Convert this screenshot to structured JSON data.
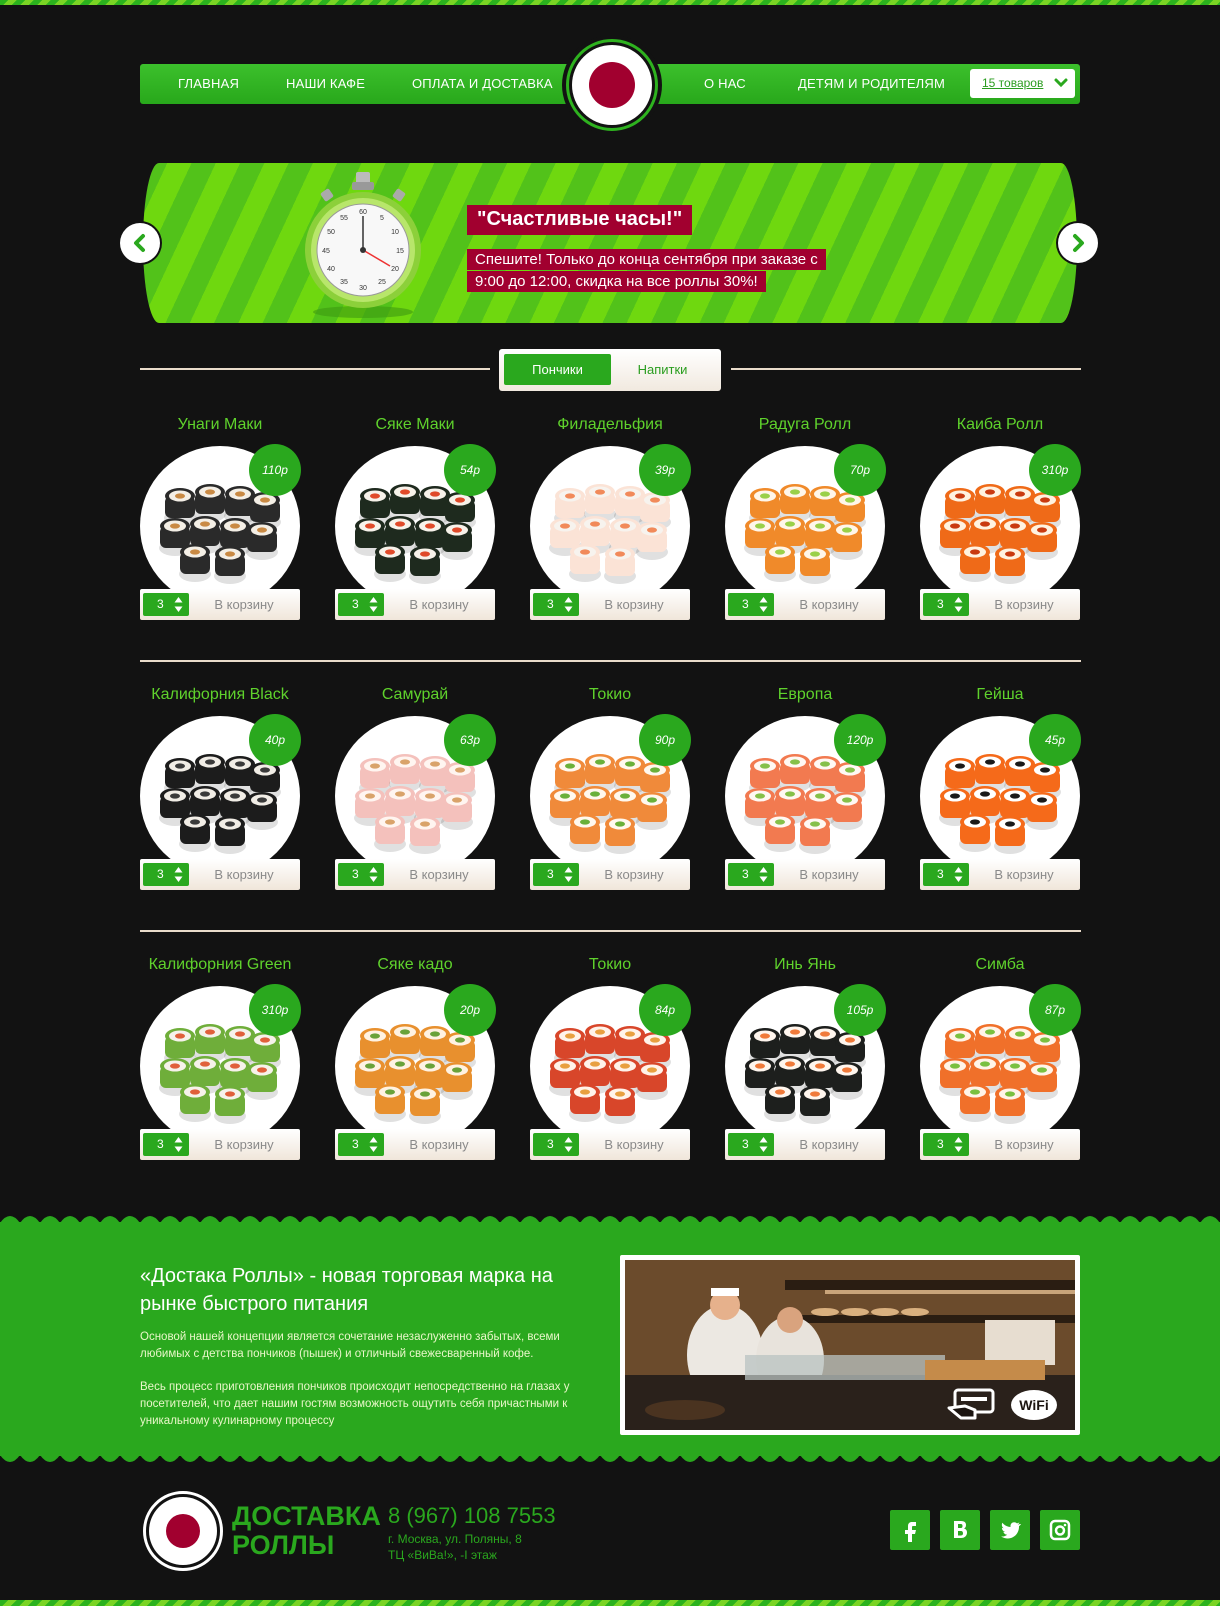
{
  "nav": {
    "left": [
      "ГЛАВНАЯ",
      "НАШИ КАФЕ",
      "ОПЛАТА И ДОСТАВКА"
    ],
    "right": [
      "О НАС",
      "ДЕТЯМ И РОДИТЕЛЯМ"
    ],
    "cart_label": "15 товаров"
  },
  "slider": {
    "title": "\"Счастливые часы!\"",
    "text": "Спешите! Только до конца сентября при заказе с 9:00 до 12:00, скидка на все роллы 30%!"
  },
  "tabs": {
    "active": "Пончики",
    "inactive": "Напитки"
  },
  "products": [
    {
      "name": "Унаги Маки",
      "price": "110р",
      "qty": "3",
      "buy": "В корзину"
    },
    {
      "name": "Сяке Маки",
      "price": "54р",
      "qty": "3",
      "buy": "В корзину"
    },
    {
      "name": "Филадельфия",
      "price": "39р",
      "qty": "3",
      "buy": "В корзину"
    },
    {
      "name": "Радуга Ролл",
      "price": "70р",
      "qty": "3",
      "buy": "В корзину"
    },
    {
      "name": "Каиба Ролл",
      "price": "310р",
      "qty": "3",
      "buy": "В корзину"
    },
    {
      "name": "Калифорния Black",
      "price": "40р",
      "qty": "3",
      "buy": "В корзину"
    },
    {
      "name": "Самурай",
      "price": "63р",
      "qty": "3",
      "buy": "В корзину"
    },
    {
      "name": "Токио",
      "price": "90р",
      "qty": "3",
      "buy": "В корзину"
    },
    {
      "name": "Европа",
      "price": "120р",
      "qty": "3",
      "buy": "В корзину"
    },
    {
      "name": "Гейша",
      "price": "45р",
      "qty": "3",
      "buy": "В корзину"
    },
    {
      "name": "Калифорния Green",
      "price": "310р",
      "qty": "3",
      "buy": "В корзину"
    },
    {
      "name": "Сяке кадо",
      "price": "20р",
      "qty": "3",
      "buy": "В корзину"
    },
    {
      "name": "Токио",
      "price": "84р",
      "qty": "3",
      "buy": "В корзину"
    },
    {
      "name": "Инь Янь",
      "price": "105р",
      "qty": "3",
      "buy": "В корзину"
    },
    {
      "name": "Симба",
      "price": "87р",
      "qty": "3",
      "buy": "В корзину"
    }
  ],
  "about": {
    "title": "«Достака Роллы» - новая торговая марка на рынке быстрого питания",
    "p1": "Основой нашей концепции является сочетание незаслуженно забытых, всеми любимых с детства пончиков (пышек) и отличный свежесваренный кофе.",
    "p2": "Весь процесс приготовления пончиков происходит непосредственно на глазах у посетителей, что дает нашим гостям возможность ощутить себя причастными к уникальному кулинарному процессу",
    "wifi_label": "WiFi"
  },
  "footer": {
    "brand_line1": "ДОСТАВКА",
    "brand_line2": "РОЛЛЫ",
    "phone": "8 (967) 108 7553",
    "addr1": "г. Москва, ул. Поляны, 8",
    "addr2": "ТЦ «ВиВа!», -I этаж"
  },
  "colors": {
    "green": "#2aa81e",
    "light_green": "#5fd22c",
    "crimson": "#a1002f",
    "bg": "#121212"
  },
  "icons": [
    "chevron-left-icon",
    "chevron-right-icon",
    "chevron-down-icon",
    "stopwatch-icon",
    "card-payment-icon",
    "wifi-icon",
    "facebook-icon",
    "vk-icon",
    "twitter-icon",
    "instagram-icon"
  ]
}
